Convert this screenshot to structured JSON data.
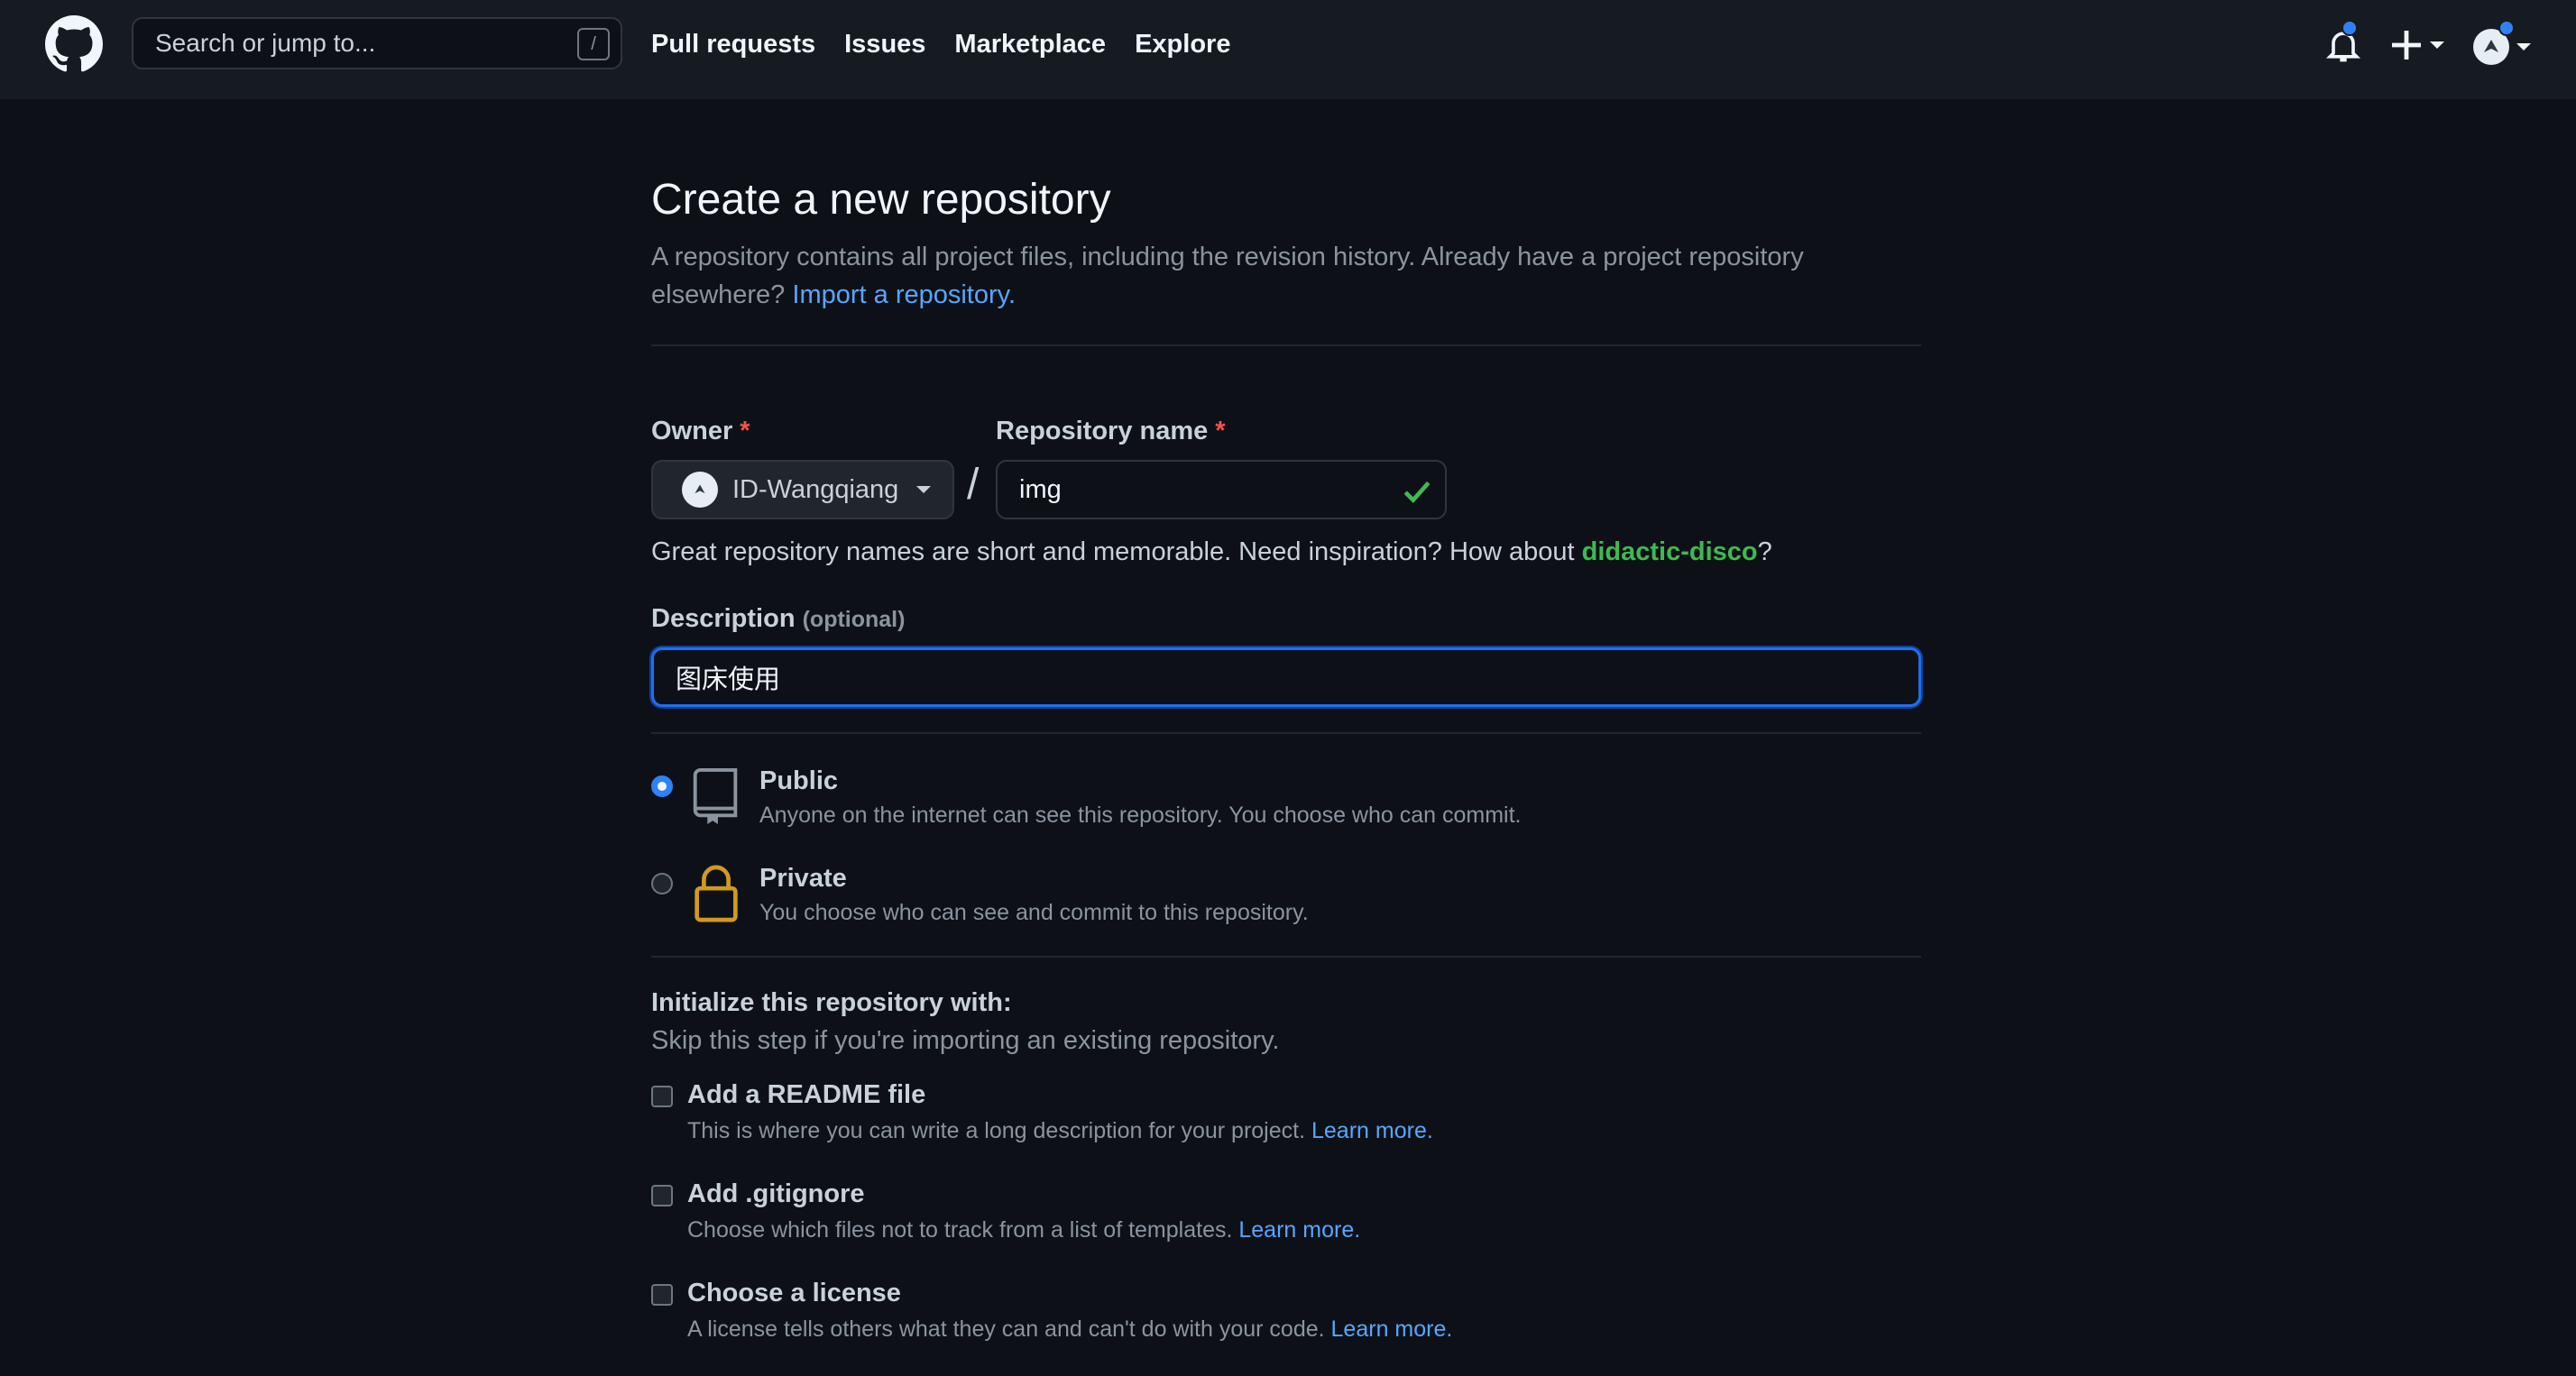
{
  "header": {
    "logo_icon": "github-mark-icon",
    "search_placeholder": "Search or jump to...",
    "search_shortcut": "/",
    "nav": [
      "Pull requests",
      "Issues",
      "Marketplace",
      "Explore"
    ],
    "notification_icon": "bell-icon",
    "create_icon": "plus-icon",
    "avatar_icon": "avatar-icon",
    "accent": "#2f81f7"
  },
  "page": {
    "title": "Create a new repository",
    "subtitle": "A repository contains all project files, including the revision history. Already have a project repository elsewhere?",
    "import_link": "Import a repository."
  },
  "form": {
    "owner_label": "Owner",
    "owner_value": "ID-Wangqiang",
    "required_mark": "*",
    "separator": "/",
    "repo_name_label": "Repository name",
    "repo_name_value": "img",
    "hint_prefix": "Great repository names are short and memorable. Need inspiration? How about",
    "hint_suggestion": "didactic-disco",
    "hint_suffix": "?",
    "description_label": "Description",
    "description_optional": "(optional)",
    "description_value": "图床使用"
  },
  "visibility": {
    "selected": "public",
    "public": {
      "title": "Public",
      "desc": "Anyone on the internet can see this repository. You choose who can commit.",
      "icon": "repo-icon"
    },
    "private": {
      "title": "Private",
      "desc": "You choose who can see and commit to this repository.",
      "icon": "lock-icon"
    }
  },
  "initialize": {
    "title": "Initialize this repository with:",
    "subtitle": "Skip this step if you're importing an existing repository.",
    "options": [
      {
        "title": "Add a README file",
        "desc": "This is where you can write a long description for your project.",
        "link": "Learn more.",
        "checked": false
      },
      {
        "title": "Add .gitignore",
        "desc": "Choose which files not to track from a list of templates.",
        "link": "Learn more.",
        "checked": false
      },
      {
        "title": "Choose a license",
        "desc": "A license tells others what they can and can't do with your code.",
        "link": "Learn more.",
        "checked": false
      }
    ]
  }
}
